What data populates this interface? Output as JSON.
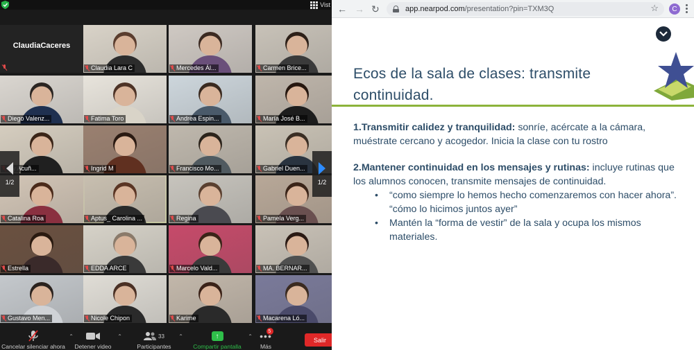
{
  "zoom": {
    "view_label": "Vist",
    "host_name": "ClaudiaCaceres",
    "participants": [
      "Claudia Lara C",
      "Mercedes Ál...",
      "Carmen Brice...",
      "Diego Valenz...",
      "Fatima Toro",
      "Andrea Espin...",
      "María José B...",
      "aly Acuñ...",
      "Ingrid M",
      "Francisco Mo...",
      "Gabriel Duen...",
      "Catalina Roa",
      "Aptus_ Carolina ...",
      "Regina",
      "Pamela Verg...",
      "Estrella",
      "EDDA ARCE",
      "Marcelo Vald...",
      "MA. BERNAR...",
      "Gustavo Men...",
      "Nicole Chipon",
      "Karime",
      "Macarena Ló..."
    ],
    "page_left": "1/2",
    "page_right": "1/2",
    "toolbar": {
      "mute_label": "Cancelar silenciar ahora",
      "video_label": "Detener video",
      "participants_label": "Participantes",
      "participants_count": "33",
      "share_label": "Compartir pantalla",
      "more_label": "Más",
      "more_badge": "5",
      "leave_label": "Salir"
    }
  },
  "browser": {
    "url_host": "app.nearpod.com",
    "url_path": "/presentation?pin=TXM3Q",
    "profile_initial": "C"
  },
  "slide": {
    "title": "Ecos de la sala de clases: transmite continuidad.",
    "point1_bold": "1.Transmitir calidez y tranquilidad:",
    "point1_text": " sonríe, acércate a la cámara, muéstrate cercano y acogedor. Inicia la clase con tu rostro",
    "point2_bold": "2.Mantener continuidad en los mensajes y rutinas:",
    "point2_text": " incluye rutinas que los alumnos conocen, transmite mensajes de continuidad.",
    "bullets": [
      "“como siempre lo hemos hecho comenzaremos con hacer ahora”. “cómo lo hicimos juntos ayer”",
      "Mantén la “forma de vestir” de la sala y ocupa los mismos materiales."
    ]
  },
  "colors": {
    "slide_text": "#2d4d68",
    "title_rule": "#8cb33a",
    "share_green": "#2fbf4a",
    "leave_red": "#e02828",
    "active_speaker": "#b8e65a"
  }
}
